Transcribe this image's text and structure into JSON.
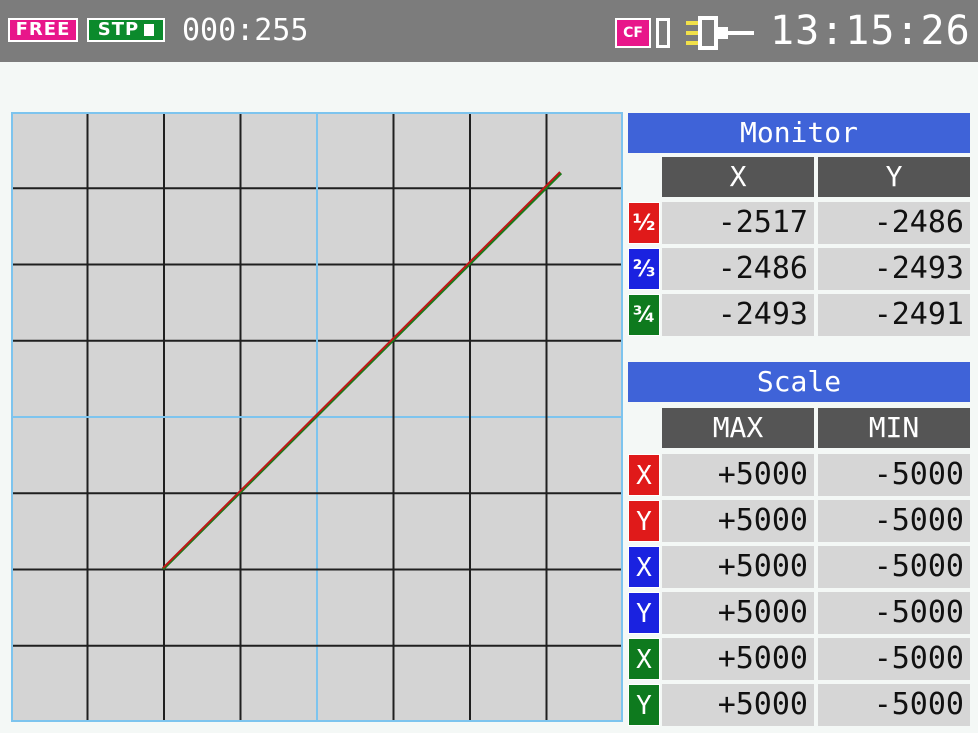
{
  "status_bar": {
    "mode_badge": "FREE",
    "state_badge": "STP",
    "counter": "000:255",
    "storage_label": "CF",
    "time": "13:15:26"
  },
  "plot": {
    "grid_divisions": 8,
    "trace_colors": [
      "#1a7a1a",
      "#c01818"
    ],
    "grid_color": "#1f1f1f",
    "center_grid_color": "#7dc4ee",
    "background": "#d4d4d4"
  },
  "monitor": {
    "title": "Monitor",
    "col_x": "X",
    "col_y": "Y",
    "rows": [
      {
        "tag": "½",
        "color": "red",
        "x": "-2517",
        "y": "-2486"
      },
      {
        "tag": "⅔",
        "color": "blue",
        "x": "-2486",
        "y": "-2493"
      },
      {
        "tag": "¾",
        "color": "green",
        "x": "-2493",
        "y": "-2491"
      }
    ]
  },
  "scale": {
    "title": "Scale",
    "col_max": "MAX",
    "col_min": "MIN",
    "rows": [
      {
        "tag": "X",
        "color": "red",
        "max": "+5000",
        "min": "-5000"
      },
      {
        "tag": "Y",
        "color": "red",
        "max": "+5000",
        "min": "-5000"
      },
      {
        "tag": "X",
        "color": "blue",
        "max": "+5000",
        "min": "-5000"
      },
      {
        "tag": "Y",
        "color": "blue",
        "max": "+5000",
        "min": "-5000"
      },
      {
        "tag": "X",
        "color": "green",
        "max": "+5000",
        "min": "-5000"
      },
      {
        "tag": "Y",
        "color": "green",
        "max": "+5000",
        "min": "-5000"
      }
    ]
  }
}
